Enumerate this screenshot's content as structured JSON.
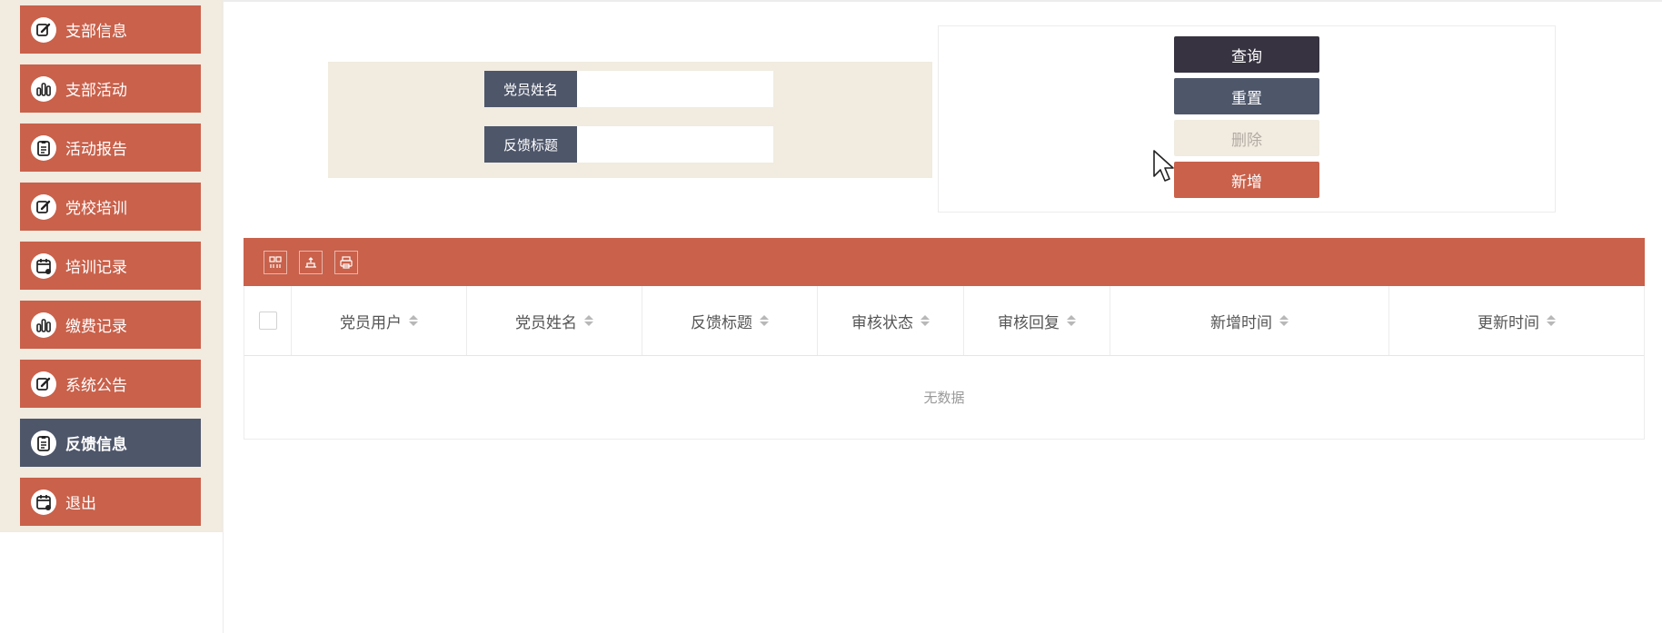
{
  "sidebar": {
    "items": [
      {
        "label": "支部信息",
        "icon": "edit-icon",
        "active": false
      },
      {
        "label": "支部活动",
        "icon": "bar-chart-icon",
        "active": false
      },
      {
        "label": "活动报告",
        "icon": "clipboard-icon",
        "active": false
      },
      {
        "label": "党校培训",
        "icon": "edit-icon",
        "active": false
      },
      {
        "label": "培训记录",
        "icon": "calendar-icon",
        "active": false
      },
      {
        "label": "缴费记录",
        "icon": "bar-chart-icon",
        "active": false
      },
      {
        "label": "系统公告",
        "icon": "edit-icon",
        "active": false
      },
      {
        "label": "反馈信息",
        "icon": "clipboard-icon",
        "active": true
      },
      {
        "label": "退出",
        "icon": "calendar-icon",
        "active": false
      }
    ]
  },
  "search": {
    "fields": [
      {
        "label": "党员姓名",
        "value": "",
        "placeholder": ""
      },
      {
        "label": "反馈标题",
        "value": "",
        "placeholder": ""
      }
    ]
  },
  "buttons": {
    "query": "查询",
    "reset": "重置",
    "delete": "删除",
    "add": "新增"
  },
  "toolbar": {
    "icons": [
      "columns-icon",
      "export-icon",
      "print-icon"
    ]
  },
  "table": {
    "columns": [
      "党员用户",
      "党员姓名",
      "反馈标题",
      "审核状态",
      "审核回复",
      "新增时间",
      "更新时间"
    ],
    "rows": [],
    "empty_text": "无数据"
  },
  "colors": {
    "primary": "#c9614b",
    "secondary": "#4e566a",
    "dark": "#373340",
    "beige": "#f1ebe0"
  }
}
